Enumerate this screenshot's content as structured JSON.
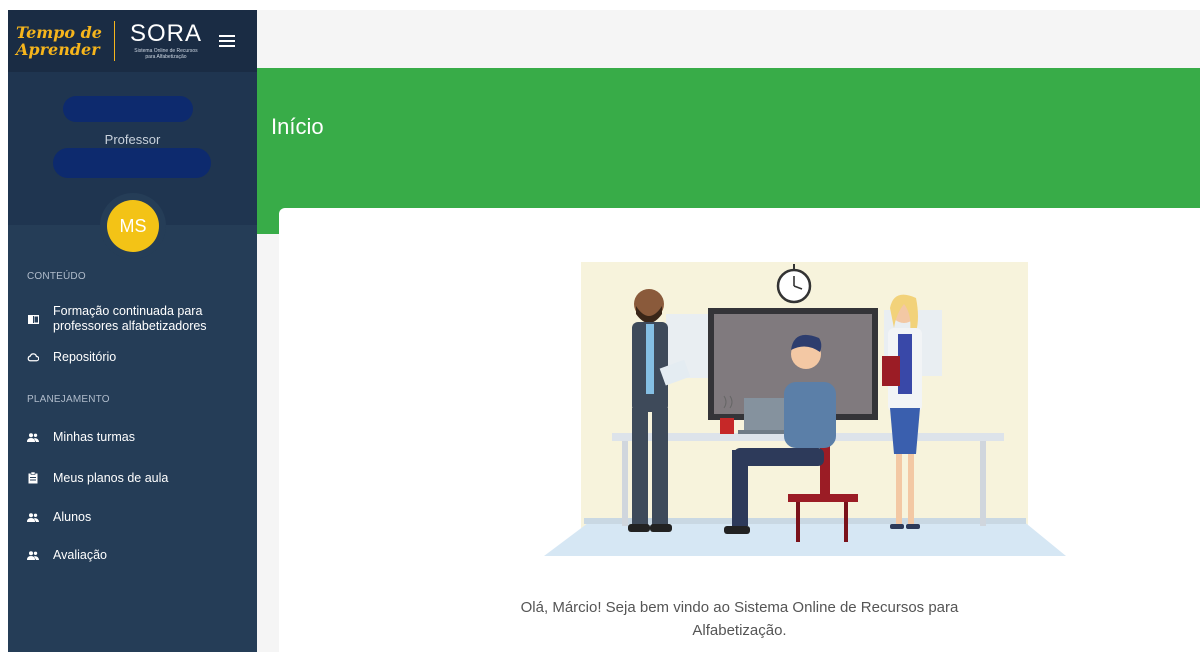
{
  "brand": {
    "tempo_line1": "Tempo de",
    "tempo_line2": "Aprender",
    "sora_title": "SORA",
    "sora_sub_line1": "Sistema Online de Recursos",
    "sora_sub_line2": "para Alfabetização"
  },
  "profile": {
    "role": "Professor",
    "initials": "MS",
    "avatar_color": "#f3c316"
  },
  "sidebar": {
    "section_content": "CONTEÚDO",
    "items_content": [
      {
        "label_line1": "Formação continuada para",
        "label_line2": "professores alfabetizadores",
        "icon": "book-icon"
      },
      {
        "label": "Repositório",
        "icon": "cloud-icon"
      }
    ],
    "section_planning": "PLANEJAMENTO",
    "items_planning": [
      {
        "label": "Minhas turmas",
        "icon": "group-icon"
      },
      {
        "label": "Meus planos de aula",
        "icon": "clipboard-icon"
      },
      {
        "label": "Alunos",
        "icon": "group-icon"
      },
      {
        "label": "Avaliação",
        "icon": "group-icon"
      }
    ]
  },
  "main": {
    "page_title": "Início",
    "welcome_line1": "Olá, Márcio! Seja bem vindo ao Sistema Online de Recursos para",
    "welcome_line2": "Alfabetização."
  },
  "colors": {
    "sidebar": "#253d57",
    "header_green": "#38ac48",
    "brand_gold": "#f6b51c"
  }
}
